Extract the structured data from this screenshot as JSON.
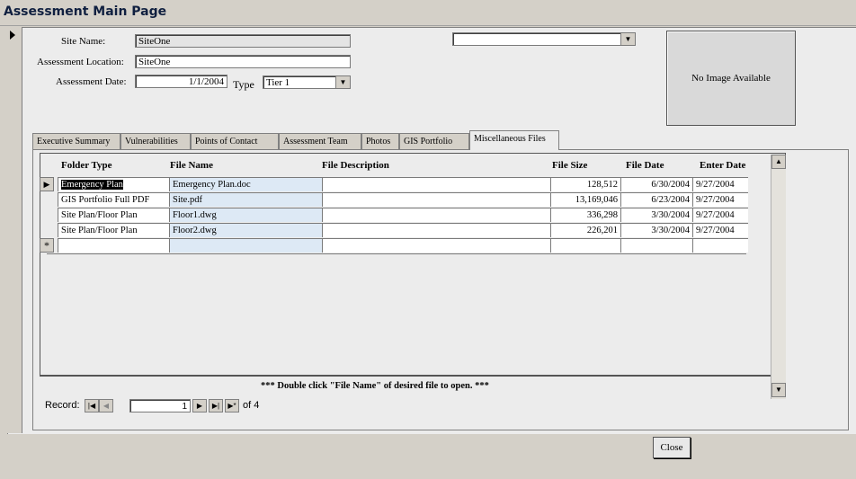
{
  "window": {
    "title": "Assessment Main Page"
  },
  "form": {
    "site_name_label": "Site Name:",
    "site_name_value": "SiteOne",
    "location_label": "Assessment Location:",
    "location_value": "SiteOne",
    "date_label": "Assessment Date:",
    "date_value": "1/1/2004",
    "type_label": "Type",
    "type_value": "Tier 1",
    "top_combo_value": "",
    "image_placeholder": "No Image Available"
  },
  "tabs": [
    {
      "label": "Executive Summary"
    },
    {
      "label": "Vulnerabilities"
    },
    {
      "label": "Points of Contact"
    },
    {
      "label": "Assessment Team"
    },
    {
      "label": "Photos"
    },
    {
      "label": "GIS Portfolio"
    },
    {
      "label": "Miscellaneous Files",
      "active": true
    }
  ],
  "table": {
    "headers": [
      "Folder Type",
      "File Name",
      "File Description",
      "File Size",
      "File Date",
      "Enter Date"
    ],
    "rows": [
      [
        "Emergency Plan",
        "Emergency Plan.doc",
        "",
        "128,512",
        "6/30/2004",
        "9/27/2004"
      ],
      [
        "GIS Portfolio Full PDF",
        "Site.pdf",
        "",
        "13,169,046",
        "6/23/2004",
        "9/27/2004"
      ],
      [
        "Site Plan/Floor Plan",
        "Floor1.dwg",
        "",
        "336,298",
        "3/30/2004",
        "9/27/2004"
      ],
      [
        "Site Plan/Floor Plan",
        "Floor2.dwg",
        "",
        "226,201",
        "3/30/2004",
        "9/27/2004"
      ]
    ],
    "new_row_marker": "*",
    "hint": "*** Double click \"File Name\" of desired file to open. ***"
  },
  "navigator": {
    "record_label": "Record:",
    "current": "1",
    "of_label": "of 4"
  },
  "close_button": "Close"
}
